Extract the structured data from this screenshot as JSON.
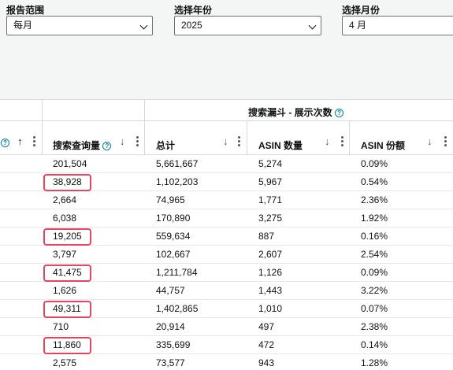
{
  "filters": {
    "report_range": {
      "label": "报告范围",
      "value": "每月"
    },
    "year": {
      "label": "选择年份",
      "value": "2025"
    },
    "month": {
      "label": "选择月份",
      "value": "4 月"
    }
  },
  "table": {
    "group_title": "搜索漏斗 - 展示次数",
    "columns": {
      "search_query_volume": "搜索查询量",
      "total": "总计",
      "asin_count": "ASIN 数量",
      "asin_share": "ASIN 份额"
    },
    "help_glyph": "?",
    "sort_up_glyph": "↑",
    "sort_down_glyph": "↓",
    "rows": [
      {
        "volume": "201,504",
        "total": "5,661,667",
        "asin_count": "5,274",
        "asin_share": "0.09%",
        "highlighted": false
      },
      {
        "volume": "38,928",
        "total": "1,102,203",
        "asin_count": "5,967",
        "asin_share": "0.54%",
        "highlighted": true
      },
      {
        "volume": "2,664",
        "total": "74,965",
        "asin_count": "1,771",
        "asin_share": "2.36%",
        "highlighted": false
      },
      {
        "volume": "6,038",
        "total": "170,890",
        "asin_count": "3,275",
        "asin_share": "1.92%",
        "highlighted": false
      },
      {
        "volume": "19,205",
        "total": "559,634",
        "asin_count": "887",
        "asin_share": "0.16%",
        "highlighted": true
      },
      {
        "volume": "3,797",
        "total": "102,667",
        "asin_count": "2,607",
        "asin_share": "2.54%",
        "highlighted": false
      },
      {
        "volume": "41,475",
        "total": "1,211,784",
        "asin_count": "1,126",
        "asin_share": "0.09%",
        "highlighted": true
      },
      {
        "volume": "1,626",
        "total": "44,757",
        "asin_count": "1,443",
        "asin_share": "3.22%",
        "highlighted": false
      },
      {
        "volume": "49,311",
        "total": "1,402,865",
        "asin_count": "1,010",
        "asin_share": "0.07%",
        "highlighted": true
      },
      {
        "volume": "710",
        "total": "20,914",
        "asin_count": "497",
        "asin_share": "2.38%",
        "highlighted": false
      },
      {
        "volume": "11,860",
        "total": "335,699",
        "asin_count": "472",
        "asin_share": "0.14%",
        "highlighted": true
      },
      {
        "volume": "2,575",
        "total": "73,577",
        "asin_count": "943",
        "asin_share": "1.28%",
        "highlighted": false
      }
    ]
  },
  "colors": {
    "highlight_border": "#e84360",
    "help_icon": "#008296"
  }
}
